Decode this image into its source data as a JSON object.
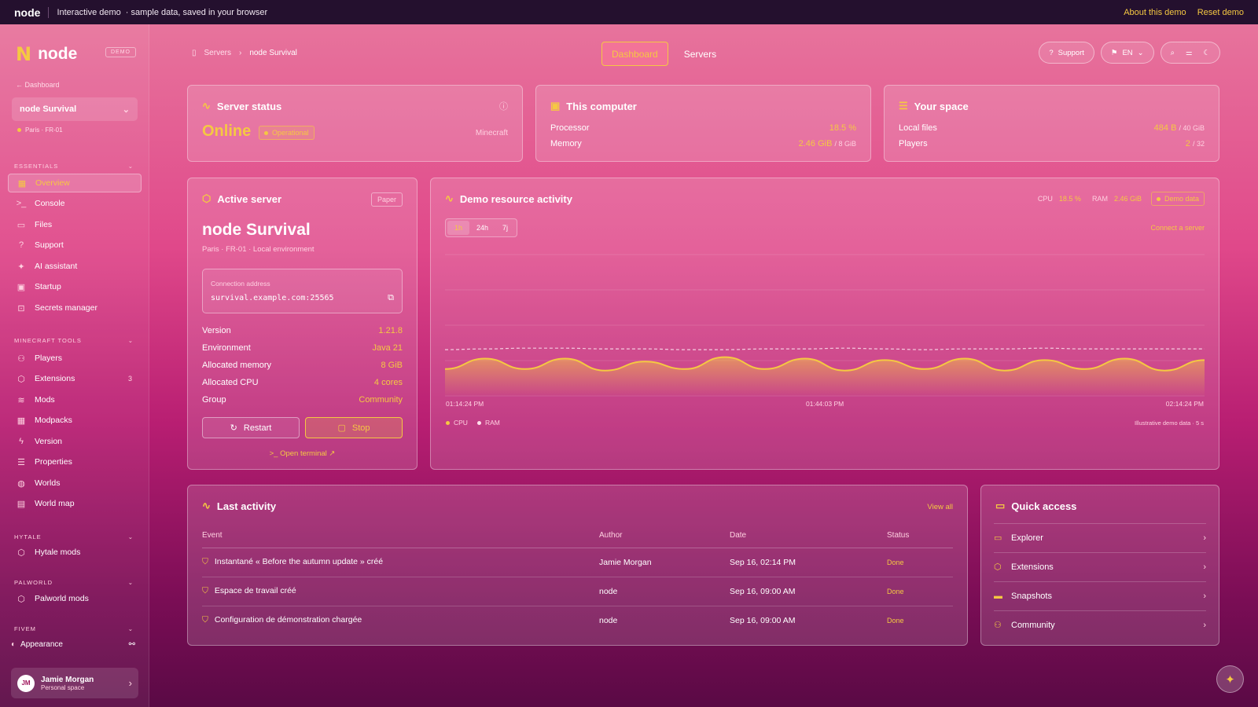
{
  "topbar": {
    "brand": "node",
    "demo": "Interactive demo",
    "note": "· sample data, saved in your browser",
    "about": "About this demo",
    "reset": "Reset demo"
  },
  "sidebar": {
    "logo_mark": "N",
    "logo_name": "node",
    "demo_badge": "DEMO",
    "back": "Dashboard",
    "server_name": "node Survival",
    "server_location": "Paris · FR-01",
    "sections": {
      "essentials": "ESSENTIALS",
      "minecraft": "MINECRAFT TOOLS",
      "hytale": "HYTALE",
      "palworld": "PALWORLD",
      "fivem": "FIVEM"
    },
    "essentials": [
      {
        "label": "Overview",
        "icon": "grid-icon"
      },
      {
        "label": "Console",
        "icon": "terminal-icon"
      },
      {
        "label": "Files",
        "icon": "folder-icon"
      },
      {
        "label": "Support",
        "icon": "help-icon"
      },
      {
        "label": "AI assistant",
        "icon": "sparkle-icon"
      },
      {
        "label": "Startup",
        "icon": "cpu-icon"
      },
      {
        "label": "Secrets manager",
        "icon": "lock-icon"
      }
    ],
    "minecraft": [
      {
        "label": "Players",
        "icon": "users-icon"
      },
      {
        "label": "Extensions",
        "icon": "box-icon",
        "count": "3"
      },
      {
        "label": "Mods",
        "icon": "layers-icon"
      },
      {
        "label": "Modpacks",
        "icon": "grid-icon"
      },
      {
        "label": "Version",
        "icon": "bolt-icon"
      },
      {
        "label": "Properties",
        "icon": "sliders-icon"
      },
      {
        "label": "Worlds",
        "icon": "globe-icon"
      },
      {
        "label": "World map",
        "icon": "map-icon"
      }
    ],
    "hytale": [
      {
        "label": "Hytale mods",
        "icon": "box-icon"
      }
    ],
    "palworld": [
      {
        "label": "Palworld mods",
        "icon": "box-icon"
      }
    ],
    "appearance": "Appearance",
    "user": {
      "initials": "JM",
      "name": "Jamie Morgan",
      "space": "Personal space"
    }
  },
  "header": {
    "crumb1": "Servers",
    "crumb2": "node Survival",
    "tab_dashboard": "Dashboard",
    "tab_servers": "Servers",
    "support": "Support",
    "lang": "EN"
  },
  "status": {
    "title": "Server status",
    "state": "Online",
    "badge": "Operational",
    "game": "Minecraft"
  },
  "computer": {
    "title": "This computer",
    "processor_label": "Processor",
    "processor": "18.5 %",
    "memory_label": "Memory",
    "memory": "2.46 GiB",
    "memory_total": "/ 8 GiB"
  },
  "space": {
    "title": "Your space",
    "files_label": "Local files",
    "files": "484 B",
    "files_total": "/ 40 GiB",
    "players_label": "Players",
    "players": "2",
    "players_total": "/ 32"
  },
  "active": {
    "title": "Active server",
    "badge": "Paper",
    "name": "node Survival",
    "meta": "Paris · FR-01 · Local environment",
    "conn_label": "Connection address",
    "conn": "survival.example.com:25565",
    "rows": [
      {
        "k": "Version",
        "v": "1.21.8"
      },
      {
        "k": "Environment",
        "v": "Java 21"
      },
      {
        "k": "Allocated memory",
        "v": "8 GiB"
      },
      {
        "k": "Allocated CPU",
        "v": "4 cores"
      },
      {
        "k": "Group",
        "v": "Community"
      }
    ],
    "restart": "Restart",
    "stop": "Stop",
    "terminal": "Open terminal"
  },
  "activity_chart": {
    "title": "Demo resource activity",
    "cpu_label": "CPU",
    "cpu": "18.5 %",
    "ram_label": "RAM",
    "ram": "2.46 GiB",
    "badge": "Demo data",
    "ranges": [
      "1h",
      "24h",
      "7j"
    ],
    "connect": "Connect a server",
    "legend_cpu": "CPU",
    "legend_ram": "RAM",
    "note": "Illustrative demo data · 5 s"
  },
  "chart_data": {
    "type": "area",
    "x": [
      "01:14:24 PM",
      "01:44:03 PM",
      "02:14:24 PM"
    ],
    "series": [
      {
        "name": "CPU",
        "values": [
          18,
          25,
          18,
          25,
          17,
          23,
          18,
          26,
          18,
          25,
          17,
          24,
          18,
          25,
          17,
          24,
          18,
          25,
          17,
          24
        ]
      },
      {
        "name": "RAM",
        "values": [
          31,
          31.5,
          32,
          32,
          31.5,
          31.5,
          31,
          31,
          31.5,
          31.5,
          32,
          31.5,
          31,
          31.5,
          31.5,
          32,
          31.5,
          31.5,
          31.5,
          31.5
        ]
      }
    ],
    "ylim": [
      0,
      100
    ]
  },
  "last": {
    "title": "Last activity",
    "view_all": "View all",
    "cols": [
      "Event",
      "Author",
      "Date",
      "Status"
    ],
    "rows": [
      {
        "event": "Instantané « Before the autumn update » créé",
        "author": "Jamie Morgan",
        "date": "Sep 16, 02:14 PM",
        "status": "Done"
      },
      {
        "event": "Espace de travail créé",
        "author": "node",
        "date": "Sep 16, 09:00 AM",
        "status": "Done"
      },
      {
        "event": "Configuration de démonstration chargée",
        "author": "node",
        "date": "Sep 16, 09:00 AM",
        "status": "Done"
      }
    ]
  },
  "quick": {
    "title": "Quick access",
    "items": [
      {
        "label": "Explorer",
        "icon": "folder-icon"
      },
      {
        "label": "Extensions",
        "icon": "box-icon"
      },
      {
        "label": "Snapshots",
        "icon": "drive-icon"
      },
      {
        "label": "Community",
        "icon": "users-icon"
      }
    ]
  }
}
